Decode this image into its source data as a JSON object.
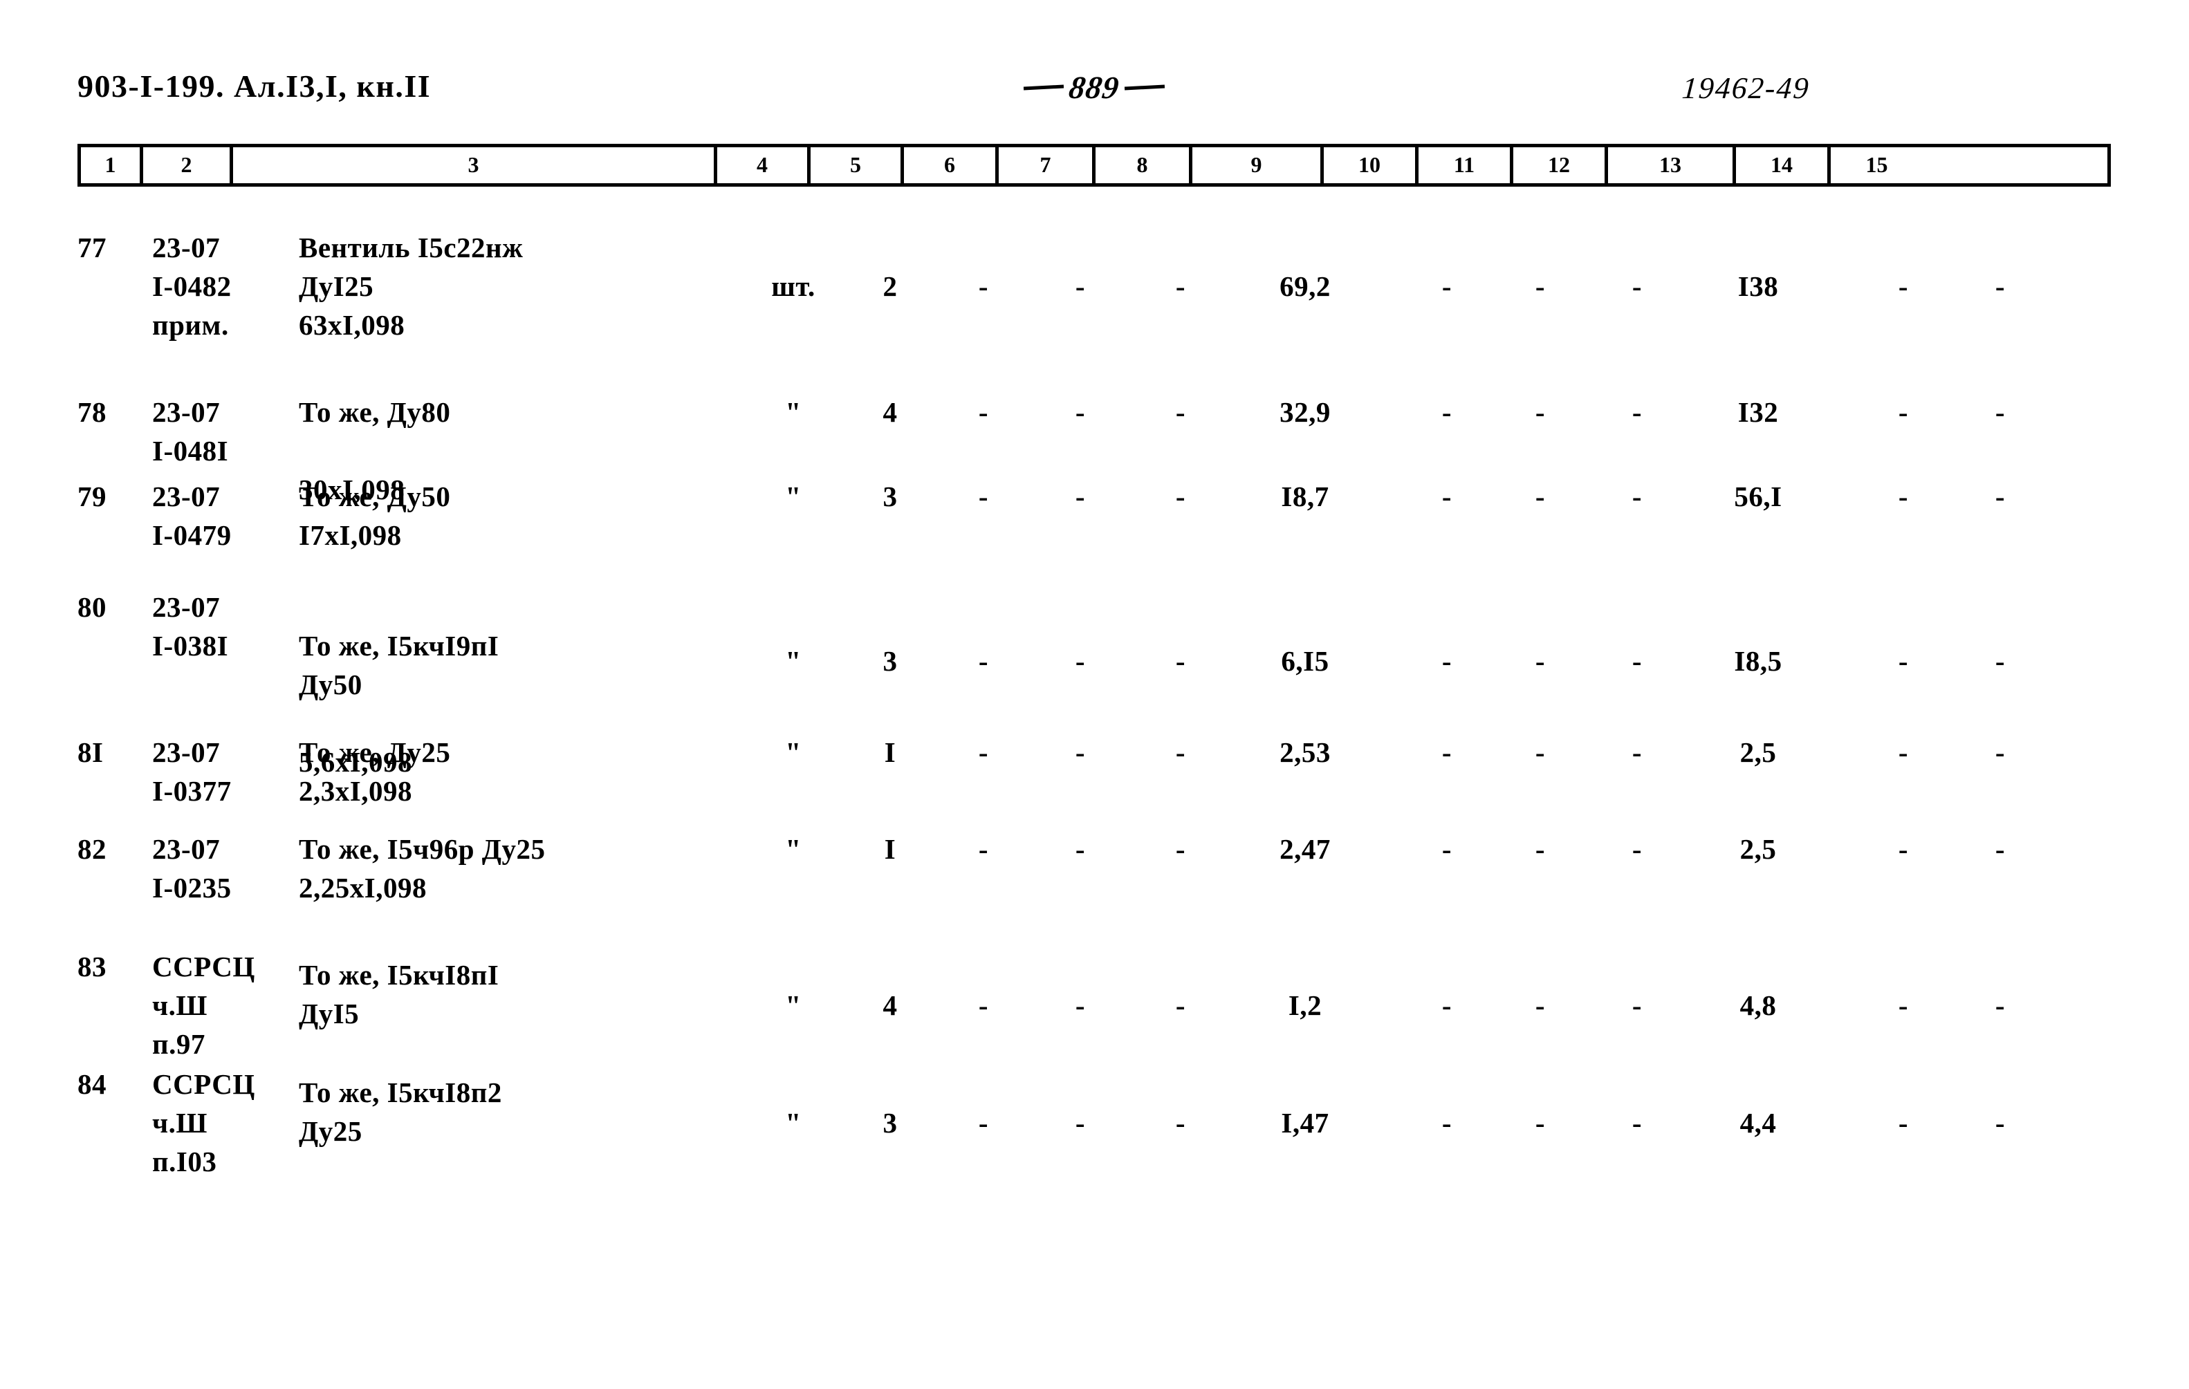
{
  "header": {
    "doc_code": "903-I-199. Ал.I3,I, кн.II",
    "page_number": "889",
    "stamp_code": "19462-49"
  },
  "table": {
    "column_numbers": [
      "1",
      "2",
      "3",
      "4",
      "5",
      "6",
      "7",
      "8",
      "9",
      "10",
      "11",
      "12",
      "13",
      "14",
      "15"
    ],
    "rows": [
      {
        "c1": "77",
        "c2": "23-07\nI-0482\nприм.",
        "c3": "Вентиль I5c22нж\nДуI25\n63xI,098",
        "c4": "шт.",
        "c5": "2",
        "c6": "-",
        "c7": "-",
        "c8": "-",
        "c9": "69,2",
        "c10": "-",
        "c11": "-",
        "c12": "-",
        "c13": "I38",
        "c14": "-",
        "c15": "-"
      },
      {
        "c1": "78",
        "c2": "23-07\nI-048I",
        "c3": "То же, Ду80\n\n30xI,098",
        "c4": "\"",
        "c5": "4",
        "c6": "-",
        "c7": "-",
        "c8": "-",
        "c9": "32,9",
        "c10": "-",
        "c11": "-",
        "c12": "-",
        "c13": "I32",
        "c14": "-",
        "c15": "-"
      },
      {
        "c1": "79",
        "c2": "23-07\nI-0479",
        "c3": "То же, Ду50\nI7xI,098",
        "c4": "\"",
        "c5": "3",
        "c6": "-",
        "c7": "-",
        "c8": "-",
        "c9": "I8,7",
        "c10": "-",
        "c11": "-",
        "c12": "-",
        "c13": "56,I",
        "c14": "-",
        "c15": "-"
      },
      {
        "c1": "80",
        "c2": "23-07\nI-038I",
        "c3": "То же, I5кчI9пI\nДу50\n\n5,6xI,098",
        "c4": "\"",
        "c5": "3",
        "c6": "-",
        "c7": "-",
        "c8": "-",
        "c9": "6,I5",
        "c10": "-",
        "c11": "-",
        "c12": "-",
        "c13": "I8,5",
        "c14": "-",
        "c15": "-"
      },
      {
        "c1": "8I",
        "c2": "23-07\nI-0377",
        "c3": "То же, Ду25\n2,3xI,098",
        "c4": "\"",
        "c5": "I",
        "c6": "-",
        "c7": "-",
        "c8": "-",
        "c9": "2,53",
        "c10": "-",
        "c11": "-",
        "c12": "-",
        "c13": "2,5",
        "c14": "-",
        "c15": "-"
      },
      {
        "c1": "82",
        "c2": "23-07\nI-0235",
        "c3": "То же, I5ч96р Ду25\n2,25xI,098",
        "c4": "\"",
        "c5": "I",
        "c6": "-",
        "c7": "-",
        "c8": "-",
        "c9": "2,47",
        "c10": "-",
        "c11": "-",
        "c12": "-",
        "c13": "2,5",
        "c14": "-",
        "c15": "-"
      },
      {
        "c1": "83",
        "c2": "ССРСЦ\nч.Ш\nп.97",
        "c3": "То же, I5кчI8пI\nДуI5",
        "c4": "\"",
        "c5": "4",
        "c6": "-",
        "c7": "-",
        "c8": "-",
        "c9": "I,2",
        "c10": "-",
        "c11": "-",
        "c12": "-",
        "c13": "4,8",
        "c14": "-",
        "c15": "-"
      },
      {
        "c1": "84",
        "c2": "ССРСЦ\nч.Ш\nп.I03",
        "c3": "То же, I5кчI8п2\nДу25",
        "c4": "\"",
        "c5": "3",
        "c6": "-",
        "c7": "-",
        "c8": "-",
        "c9": "I,47",
        "c10": "-",
        "c11": "-",
        "c12": "-",
        "c13": "4,4",
        "c14": "-",
        "c15": "-"
      }
    ]
  }
}
